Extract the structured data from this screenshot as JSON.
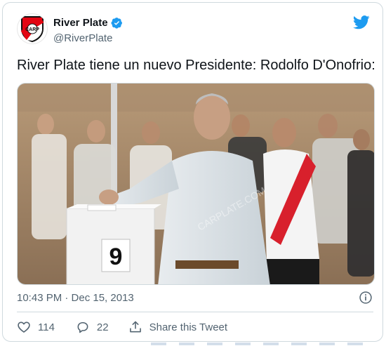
{
  "author": {
    "name": "River Plate",
    "handle": "@RiverPlate",
    "avatar_icon": "river-plate-crest",
    "verified_icon": "verified-badge-icon"
  },
  "brand": {
    "icon": "twitter-bird-icon",
    "color": "#1d9bf0"
  },
  "tweet": {
    "text": "River Plate tiene un nuevo Presidente: Rodolfo D'Onofrio:",
    "timestamp": "10:43 PM · Dec 15, 2013"
  },
  "photo": {
    "ballot_box_number": "9",
    "watermark": "CARPLATE.COM"
  },
  "actions": {
    "like_count": "114",
    "reply_count": "22",
    "share_label": "Share this Tweet"
  },
  "colors": {
    "text_primary": "#0f1419",
    "text_secondary": "#536471",
    "border": "#cfd9de"
  }
}
